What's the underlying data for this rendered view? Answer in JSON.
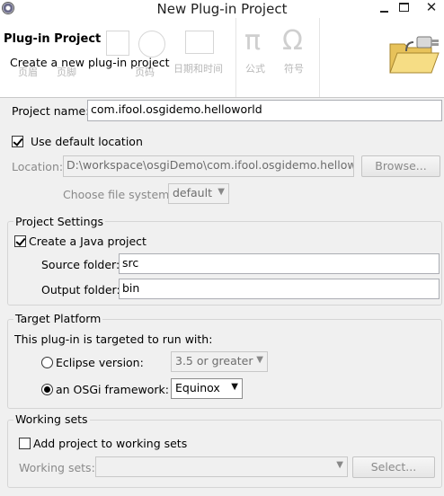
{
  "window": {
    "title": "New Plug-in Project",
    "close_glyph": "✕"
  },
  "header": {
    "title": "Plug-in Project",
    "description": "Create a new plug-in project",
    "image_icon": "folder-plugin-icon",
    "background_ribbon": {
      "date_label": "日期和时间",
      "formula_label": "公式",
      "symbol_label": "符号",
      "symbol_group_label": "符号",
      "pi_glyph": "π",
      "omega_glyph": "Ω",
      "left_label_1": "页眉",
      "left_label_2": "页脚",
      "left_label_3": "页码"
    }
  },
  "project": {
    "name_label": "Project name:",
    "name_value": "com.ifool.osgidemo.helloworld",
    "use_default_label": "Use default location",
    "use_default_checked": true,
    "location_label": "Location:",
    "location_value": "D:\\workspace\\osgiDemo\\com.ifool.osgidemo.helloworld",
    "browse_label": "Browse...",
    "file_system_label": "Choose file system:",
    "file_system_value": "default"
  },
  "settings": {
    "group_label": "Project Settings",
    "create_java_label": "Create a Java project",
    "create_java_checked": true,
    "source_label": "Source folder:",
    "source_value": "src",
    "output_label": "Output folder:",
    "output_value": "bin"
  },
  "target": {
    "group_label": "Target Platform",
    "intro": "This plug-in is targeted to run with:",
    "eclipse_label": "Eclipse version:",
    "eclipse_value": "3.5 or greater",
    "osgi_label": "an OSGi framework:",
    "osgi_value": "Equinox",
    "selected": "osgi"
  },
  "working_sets": {
    "group_label": "Working sets",
    "add_label": "Add project to working sets",
    "add_checked": false,
    "sets_label": "Working sets:",
    "sets_value": "",
    "select_label": "Select..."
  },
  "colors": {
    "dialog_bg": "#f0f0f0",
    "banner_bg": "#ffffff",
    "disabled_text": "#8a8a8a"
  }
}
